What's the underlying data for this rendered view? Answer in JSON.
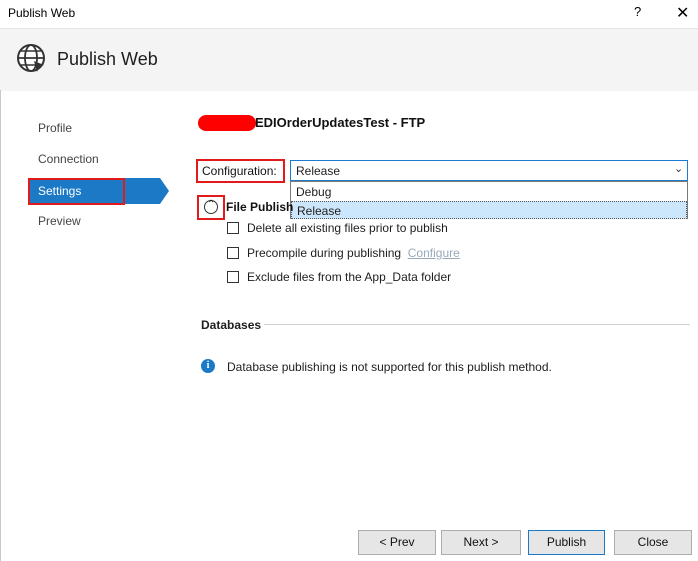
{
  "window": {
    "title": "Publish Web",
    "help_glyph": "?",
    "close_glyph": "✕"
  },
  "header": {
    "title": "Publish Web",
    "icon": "globe-icon"
  },
  "nav": {
    "items": [
      {
        "label": "Profile"
      },
      {
        "label": "Connection"
      },
      {
        "label": "Settings",
        "active": true
      },
      {
        "label": "Preview"
      }
    ]
  },
  "profile": {
    "title": "EDIOrderUpdatesTest - FTP"
  },
  "configuration": {
    "label": "Configuration:",
    "value": "Release",
    "options": [
      "Debug",
      "Release"
    ]
  },
  "file_publish": {
    "label": "File Publish",
    "options": [
      {
        "label": "Delete all existing files prior to publish",
        "checked": false
      },
      {
        "label": "Precompile during publishing",
        "checked": false,
        "link": "Configure"
      },
      {
        "label": "Exclude files from the App_Data folder",
        "checked": false
      }
    ]
  },
  "databases": {
    "title": "Databases",
    "message": "Database publishing is not supported for this publish method."
  },
  "buttons": {
    "prev": "< Prev",
    "next": "Next >",
    "publish": "Publish",
    "close": "Close"
  },
  "colors": {
    "accent": "#1b79c6",
    "highlight": "#e11b1b"
  }
}
